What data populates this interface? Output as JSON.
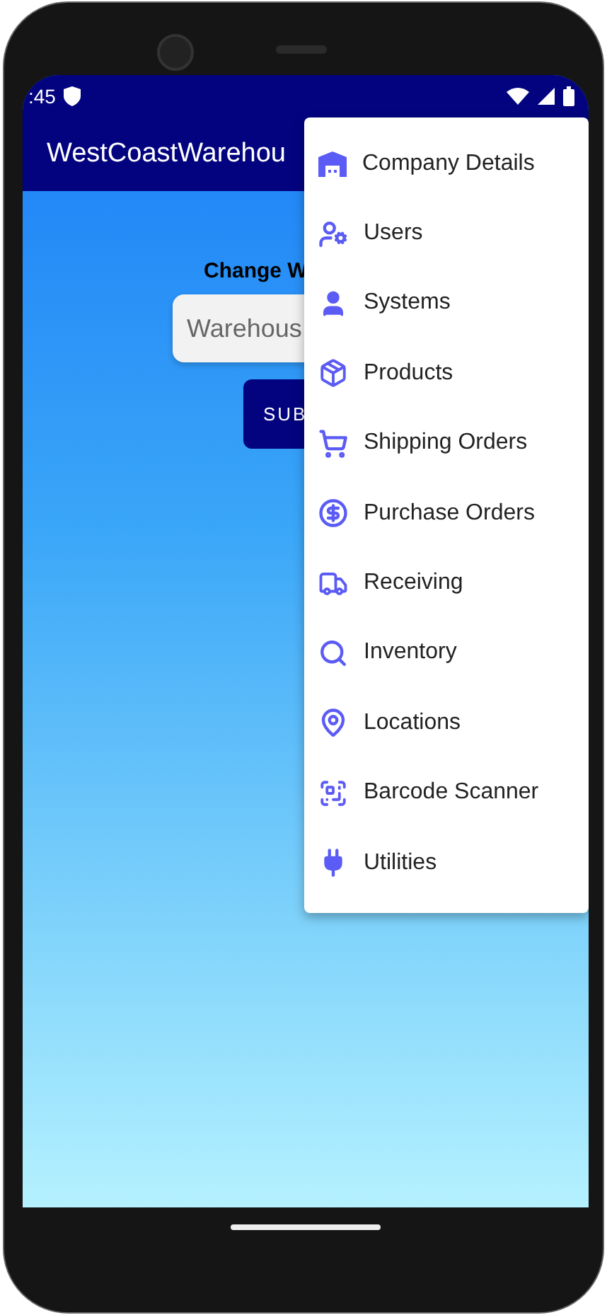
{
  "status_bar": {
    "time": ":45"
  },
  "app_bar": {
    "title": "WestCoastWarehou"
  },
  "form": {
    "heading": "Change W",
    "placeholder": "Warehous",
    "button": "SUB"
  },
  "menu": {
    "items": [
      {
        "label": "Company Details",
        "kind": "warehouse"
      },
      {
        "label": "Users",
        "kind": "usergear"
      },
      {
        "label": "Systems",
        "kind": "person"
      },
      {
        "label": "Products",
        "kind": "box"
      },
      {
        "label": "Shipping Orders",
        "kind": "cart"
      },
      {
        "label": "Purchase Orders",
        "kind": "dollar"
      },
      {
        "label": "Receiving",
        "kind": "truck"
      },
      {
        "label": "Inventory",
        "kind": "search"
      },
      {
        "label": "Locations",
        "kind": "pin"
      },
      {
        "label": "Barcode Scanner",
        "kind": "qr"
      },
      {
        "label": "Utilities",
        "kind": "plug"
      }
    ]
  }
}
